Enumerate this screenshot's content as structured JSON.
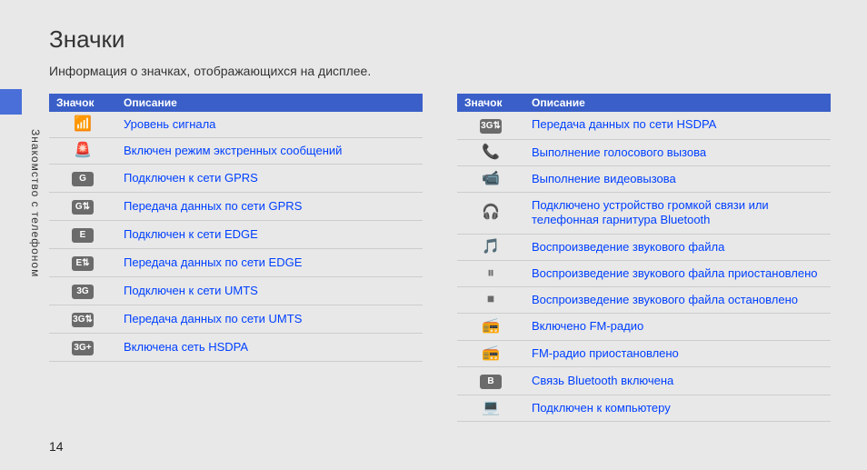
{
  "sideLabel": "Знакомство с телефоном",
  "title": "Значки",
  "intro": "Информация о значках, отображающихся на дисплее.",
  "headers": {
    "icon": "Значок",
    "desc": "Описание"
  },
  "pageNumber": "14",
  "leftRows": [
    {
      "glyph": "📶",
      "plain": true,
      "name": "signal-icon",
      "desc": "Уровень сигнала"
    },
    {
      "glyph": "🚨",
      "plain": true,
      "name": "emergency-icon",
      "desc": "Включен режим экстренных сообщений"
    },
    {
      "glyph": "G",
      "plain": false,
      "name": "gprs-icon",
      "desc": "Подключен к сети GPRS"
    },
    {
      "glyph": "G⇅",
      "plain": false,
      "name": "gprs-data-icon",
      "desc": "Передача данных по сети GPRS"
    },
    {
      "glyph": "E",
      "plain": false,
      "name": "edge-icon",
      "desc": "Подключен к сети EDGE"
    },
    {
      "glyph": "E⇅",
      "plain": false,
      "name": "edge-data-icon",
      "desc": "Передача данных по сети EDGE"
    },
    {
      "glyph": "3G",
      "plain": false,
      "name": "umts-icon",
      "desc": "Подключен к сети UMTS"
    },
    {
      "glyph": "3G⇅",
      "plain": false,
      "name": "umts-data-icon",
      "desc": "Передача данных по сети UMTS"
    },
    {
      "glyph": "3G+",
      "plain": false,
      "name": "hsdpa-icon",
      "desc": "Включена сеть HSDPA"
    }
  ],
  "rightRows": [
    {
      "glyph": "3G⇅",
      "plain": false,
      "name": "hsdpa-data-icon",
      "desc": "Передача данных по сети HSDPA"
    },
    {
      "glyph": "📞",
      "plain": true,
      "name": "voice-call-icon",
      "desc": "Выполнение голосового вызова"
    },
    {
      "glyph": "📹",
      "plain": true,
      "name": "video-call-icon",
      "desc": "Выполнение видеовызова"
    },
    {
      "glyph": "🎧",
      "plain": true,
      "name": "bt-headset-icon",
      "desc": "Подключено устройство громкой связи или телефонная гарнитура Bluetooth"
    },
    {
      "glyph": "🎵",
      "plain": true,
      "name": "audio-play-icon",
      "desc": "Воспроизведение звукового файла"
    },
    {
      "glyph": "⏸",
      "plain": true,
      "name": "audio-pause-icon",
      "desc": "Воспроизведение звукового файла приостановлено"
    },
    {
      "glyph": "⏹",
      "plain": true,
      "name": "audio-stop-icon",
      "desc": "Воспроизведение звукового файла остановлено"
    },
    {
      "glyph": "📻",
      "plain": true,
      "name": "fm-on-icon",
      "desc": "Включено FM-радио"
    },
    {
      "glyph": "📻",
      "plain": true,
      "name": "fm-pause-icon",
      "desc": "FM-радио приостановлено"
    },
    {
      "glyph": "B",
      "plain": false,
      "name": "bluetooth-icon",
      "desc": "Связь Bluetooth включена"
    },
    {
      "glyph": "💻",
      "plain": true,
      "name": "pc-connect-icon",
      "desc": "Подключен к компьютеру"
    }
  ]
}
